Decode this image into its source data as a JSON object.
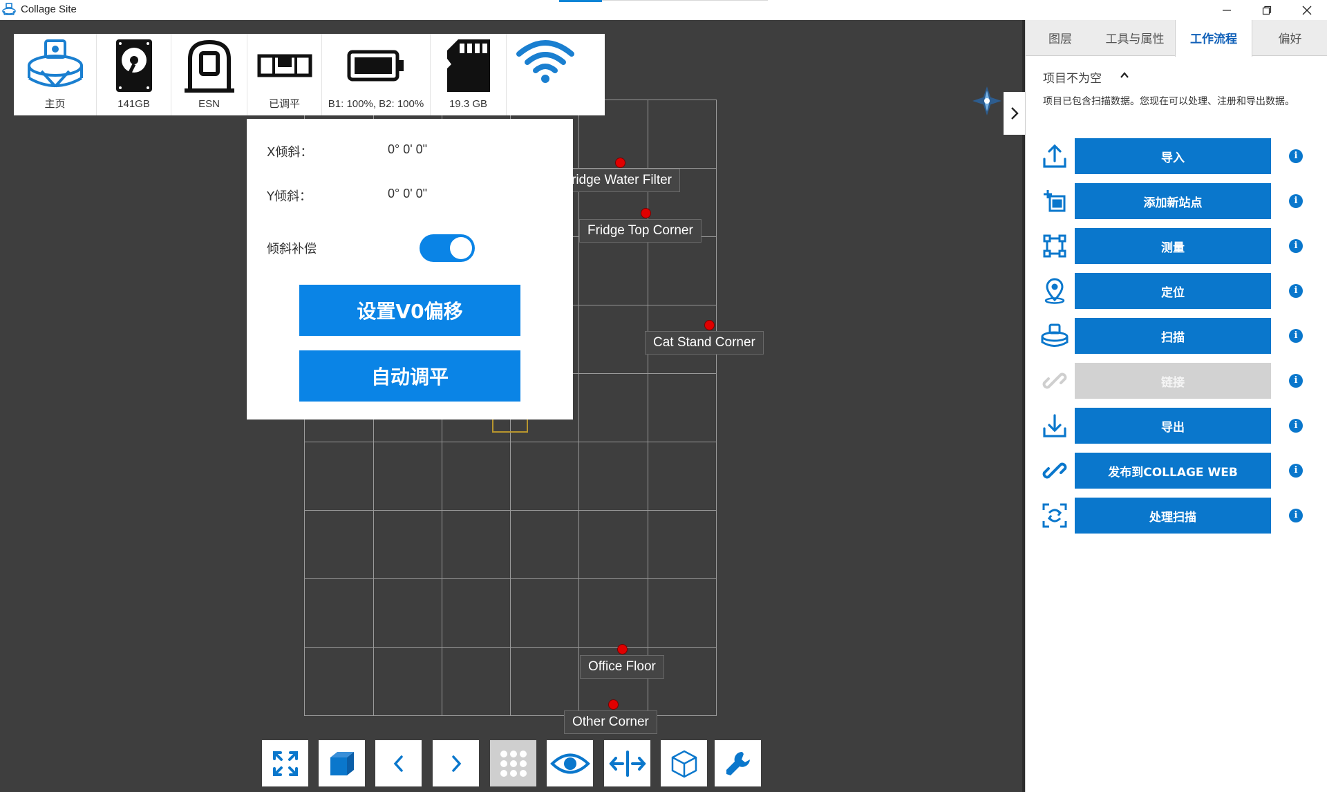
{
  "window": {
    "title": "Collage Site",
    "minimize_icon": "minimize-icon",
    "restore_icon": "restore-icon",
    "close_icon": "close-icon"
  },
  "status_bar": {
    "items": [
      {
        "icon": "scanner-home-icon",
        "label": "主页"
      },
      {
        "icon": "hard-drive-icon",
        "label": "141GB"
      },
      {
        "icon": "esn-scanner-icon",
        "label": "ESN"
      },
      {
        "icon": "level-icon",
        "label": "已调平"
      },
      {
        "icon": "battery-icon",
        "label": "B1: 100%, B2: 100%"
      },
      {
        "icon": "sd-card-icon",
        "label": "19.3 GB"
      },
      {
        "icon": "wifi-icon",
        "label": ""
      }
    ]
  },
  "tilt_popup": {
    "x_label": "X倾斜：",
    "x_value": "0° 0' 0\"",
    "y_label": "Y倾斜：",
    "y_value": "0° 0' 0\"",
    "comp_label": "倾斜补偿",
    "comp_enabled": true,
    "set_v0_button": "设置V0偏移",
    "auto_level_button": "自动调平"
  },
  "map": {
    "points": [
      {
        "label": "ridge Water Filter"
      },
      {
        "label": "Fridge Top Corner"
      },
      {
        "label": "Cat Stand Corner"
      },
      {
        "label": "Office Floor"
      },
      {
        "label": "Other Corner"
      }
    ]
  },
  "bottom_toolbar": {
    "items": [
      {
        "icon": "fullscreen-icon"
      },
      {
        "icon": "cube-solid-icon"
      },
      {
        "icon": "chevron-left-icon"
      },
      {
        "icon": "chevron-right-icon"
      },
      {
        "icon": "grid-dots-icon",
        "active": true
      },
      {
        "icon": "eye-icon"
      },
      {
        "icon": "split-view-icon"
      },
      {
        "icon": "cube-outline-icon"
      },
      {
        "icon": "wrench-icon"
      }
    ]
  },
  "panel": {
    "tabs": [
      {
        "label": "图层"
      },
      {
        "label": "工具与属性"
      },
      {
        "label": "工作流程",
        "active": true
      },
      {
        "label": "偏好"
      }
    ],
    "section_title": "项目不为空",
    "section_desc": "项目已包含扫描数据。您现在可以处理、注册和导出数据。",
    "workflow": [
      {
        "icon": "upload-icon",
        "label": "导入",
        "enabled": true
      },
      {
        "icon": "add-station-icon",
        "label": "添加新站点",
        "enabled": true
      },
      {
        "icon": "measure-icon",
        "label": "测量",
        "enabled": true
      },
      {
        "icon": "location-pin-icon",
        "label": "定位",
        "enabled": true
      },
      {
        "icon": "scan-icon",
        "label": "扫描",
        "enabled": true
      },
      {
        "icon": "link-icon",
        "label": "链接",
        "enabled": false
      },
      {
        "icon": "download-icon",
        "label": "导出",
        "enabled": true
      },
      {
        "icon": "publish-link-icon",
        "label": "发布到COLLAGE WEB",
        "enabled": true
      },
      {
        "icon": "process-scan-icon",
        "label": "处理扫描",
        "enabled": true
      }
    ],
    "info_glyph": "i"
  },
  "colors": {
    "accent": "#0a77cc",
    "popup_accent": "#0a84e6",
    "viewport_bg": "#3e3e3e",
    "point_red": "#e00000"
  }
}
